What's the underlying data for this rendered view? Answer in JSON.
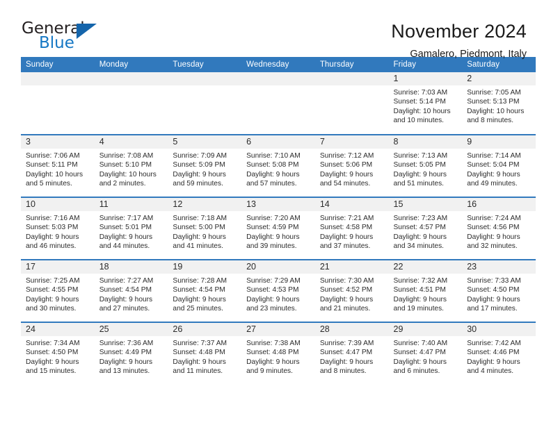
{
  "logo": {
    "word_one": "General",
    "word_two": "Blue",
    "triangle_color": "#1565ab"
  },
  "header": {
    "title": "November 2024",
    "location": "Gamalero, Piedmont, Italy"
  },
  "colors": {
    "header_blue": "#3179bd",
    "daynum_band": "#f1f1f1",
    "text": "#2b2b2b"
  },
  "weekday_headers": [
    "Sunday",
    "Monday",
    "Tuesday",
    "Wednesday",
    "Thursday",
    "Friday",
    "Saturday"
  ],
  "labels": {
    "sunrise": "Sunrise:",
    "sunset": "Sunset:",
    "daylight": "Daylight:"
  },
  "weeks": [
    [
      {
        "day": "",
        "blank": true
      },
      {
        "day": "",
        "blank": true
      },
      {
        "day": "",
        "blank": true
      },
      {
        "day": "",
        "blank": true
      },
      {
        "day": "",
        "blank": true
      },
      {
        "day": "1",
        "sunrise": "Sunrise: 7:03 AM",
        "sunset": "Sunset: 5:14 PM",
        "daylight_1": "Daylight: 10 hours",
        "daylight_2": "and 10 minutes."
      },
      {
        "day": "2",
        "sunrise": "Sunrise: 7:05 AM",
        "sunset": "Sunset: 5:13 PM",
        "daylight_1": "Daylight: 10 hours",
        "daylight_2": "and 8 minutes."
      }
    ],
    [
      {
        "day": "3",
        "sunrise": "Sunrise: 7:06 AM",
        "sunset": "Sunset: 5:11 PM",
        "daylight_1": "Daylight: 10 hours",
        "daylight_2": "and 5 minutes."
      },
      {
        "day": "4",
        "sunrise": "Sunrise: 7:08 AM",
        "sunset": "Sunset: 5:10 PM",
        "daylight_1": "Daylight: 10 hours",
        "daylight_2": "and 2 minutes."
      },
      {
        "day": "5",
        "sunrise": "Sunrise: 7:09 AM",
        "sunset": "Sunset: 5:09 PM",
        "daylight_1": "Daylight: 9 hours",
        "daylight_2": "and 59 minutes."
      },
      {
        "day": "6",
        "sunrise": "Sunrise: 7:10 AM",
        "sunset": "Sunset: 5:08 PM",
        "daylight_1": "Daylight: 9 hours",
        "daylight_2": "and 57 minutes."
      },
      {
        "day": "7",
        "sunrise": "Sunrise: 7:12 AM",
        "sunset": "Sunset: 5:06 PM",
        "daylight_1": "Daylight: 9 hours",
        "daylight_2": "and 54 minutes."
      },
      {
        "day": "8",
        "sunrise": "Sunrise: 7:13 AM",
        "sunset": "Sunset: 5:05 PM",
        "daylight_1": "Daylight: 9 hours",
        "daylight_2": "and 51 minutes."
      },
      {
        "day": "9",
        "sunrise": "Sunrise: 7:14 AM",
        "sunset": "Sunset: 5:04 PM",
        "daylight_1": "Daylight: 9 hours",
        "daylight_2": "and 49 minutes."
      }
    ],
    [
      {
        "day": "10",
        "sunrise": "Sunrise: 7:16 AM",
        "sunset": "Sunset: 5:03 PM",
        "daylight_1": "Daylight: 9 hours",
        "daylight_2": "and 46 minutes."
      },
      {
        "day": "11",
        "sunrise": "Sunrise: 7:17 AM",
        "sunset": "Sunset: 5:01 PM",
        "daylight_1": "Daylight: 9 hours",
        "daylight_2": "and 44 minutes."
      },
      {
        "day": "12",
        "sunrise": "Sunrise: 7:18 AM",
        "sunset": "Sunset: 5:00 PM",
        "daylight_1": "Daylight: 9 hours",
        "daylight_2": "and 41 minutes."
      },
      {
        "day": "13",
        "sunrise": "Sunrise: 7:20 AM",
        "sunset": "Sunset: 4:59 PM",
        "daylight_1": "Daylight: 9 hours",
        "daylight_2": "and 39 minutes."
      },
      {
        "day": "14",
        "sunrise": "Sunrise: 7:21 AM",
        "sunset": "Sunset: 4:58 PM",
        "daylight_1": "Daylight: 9 hours",
        "daylight_2": "and 37 minutes."
      },
      {
        "day": "15",
        "sunrise": "Sunrise: 7:23 AM",
        "sunset": "Sunset: 4:57 PM",
        "daylight_1": "Daylight: 9 hours",
        "daylight_2": "and 34 minutes."
      },
      {
        "day": "16",
        "sunrise": "Sunrise: 7:24 AM",
        "sunset": "Sunset: 4:56 PM",
        "daylight_1": "Daylight: 9 hours",
        "daylight_2": "and 32 minutes."
      }
    ],
    [
      {
        "day": "17",
        "sunrise": "Sunrise: 7:25 AM",
        "sunset": "Sunset: 4:55 PM",
        "daylight_1": "Daylight: 9 hours",
        "daylight_2": "and 30 minutes."
      },
      {
        "day": "18",
        "sunrise": "Sunrise: 7:27 AM",
        "sunset": "Sunset: 4:54 PM",
        "daylight_1": "Daylight: 9 hours",
        "daylight_2": "and 27 minutes."
      },
      {
        "day": "19",
        "sunrise": "Sunrise: 7:28 AM",
        "sunset": "Sunset: 4:54 PM",
        "daylight_1": "Daylight: 9 hours",
        "daylight_2": "and 25 minutes."
      },
      {
        "day": "20",
        "sunrise": "Sunrise: 7:29 AM",
        "sunset": "Sunset: 4:53 PM",
        "daylight_1": "Daylight: 9 hours",
        "daylight_2": "and 23 minutes."
      },
      {
        "day": "21",
        "sunrise": "Sunrise: 7:30 AM",
        "sunset": "Sunset: 4:52 PM",
        "daylight_1": "Daylight: 9 hours",
        "daylight_2": "and 21 minutes."
      },
      {
        "day": "22",
        "sunrise": "Sunrise: 7:32 AM",
        "sunset": "Sunset: 4:51 PM",
        "daylight_1": "Daylight: 9 hours",
        "daylight_2": "and 19 minutes."
      },
      {
        "day": "23",
        "sunrise": "Sunrise: 7:33 AM",
        "sunset": "Sunset: 4:50 PM",
        "daylight_1": "Daylight: 9 hours",
        "daylight_2": "and 17 minutes."
      }
    ],
    [
      {
        "day": "24",
        "sunrise": "Sunrise: 7:34 AM",
        "sunset": "Sunset: 4:50 PM",
        "daylight_1": "Daylight: 9 hours",
        "daylight_2": "and 15 minutes."
      },
      {
        "day": "25",
        "sunrise": "Sunrise: 7:36 AM",
        "sunset": "Sunset: 4:49 PM",
        "daylight_1": "Daylight: 9 hours",
        "daylight_2": "and 13 minutes."
      },
      {
        "day": "26",
        "sunrise": "Sunrise: 7:37 AM",
        "sunset": "Sunset: 4:48 PM",
        "daylight_1": "Daylight: 9 hours",
        "daylight_2": "and 11 minutes."
      },
      {
        "day": "27",
        "sunrise": "Sunrise: 7:38 AM",
        "sunset": "Sunset: 4:48 PM",
        "daylight_1": "Daylight: 9 hours",
        "daylight_2": "and 9 minutes."
      },
      {
        "day": "28",
        "sunrise": "Sunrise: 7:39 AM",
        "sunset": "Sunset: 4:47 PM",
        "daylight_1": "Daylight: 9 hours",
        "daylight_2": "and 8 minutes."
      },
      {
        "day": "29",
        "sunrise": "Sunrise: 7:40 AM",
        "sunset": "Sunset: 4:47 PM",
        "daylight_1": "Daylight: 9 hours",
        "daylight_2": "and 6 minutes."
      },
      {
        "day": "30",
        "sunrise": "Sunrise: 7:42 AM",
        "sunset": "Sunset: 4:46 PM",
        "daylight_1": "Daylight: 9 hours",
        "daylight_2": "and 4 minutes."
      }
    ]
  ]
}
